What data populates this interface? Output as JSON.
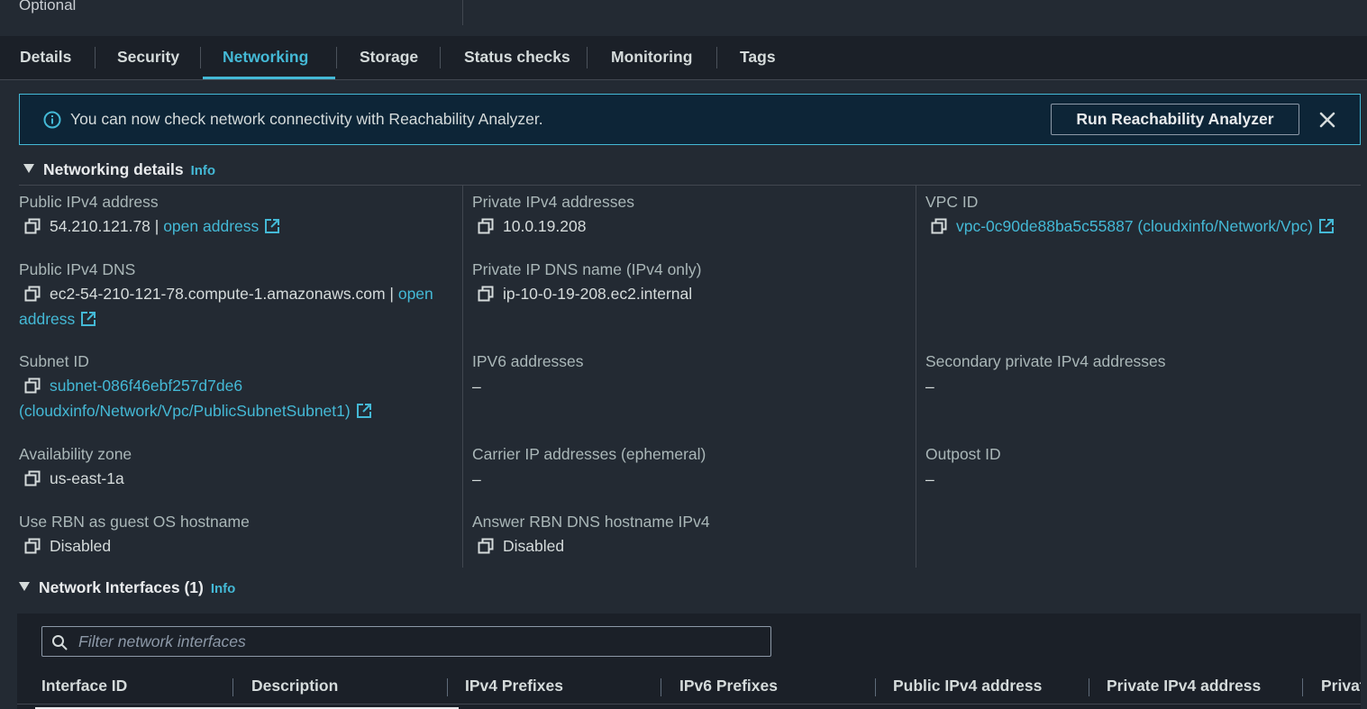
{
  "top": {
    "optional_label": "Optional"
  },
  "tabs": [
    {
      "label": "Details"
    },
    {
      "label": "Security"
    },
    {
      "label": "Networking"
    },
    {
      "label": "Storage"
    },
    {
      "label": "Status checks"
    },
    {
      "label": "Monitoring"
    },
    {
      "label": "Tags"
    }
  ],
  "active_tab": "Networking",
  "alert": {
    "message": "You can now check network connectivity with Reachability Analyzer.",
    "button_label": "Run Reachability Analyzer"
  },
  "networking_details": {
    "title": "Networking details",
    "info": "Info",
    "public_ipv4": {
      "label": "Public IPv4 address",
      "value": "54.210.121.78",
      "sep": " | ",
      "link": "open address"
    },
    "private_ipv4": {
      "label": "Private IPv4 addresses",
      "value": "10.0.19.208"
    },
    "vpc_id": {
      "label": "VPC ID",
      "link": "vpc-0c90de88ba5c55887 (cloudxinfo/Network/Vpc)"
    },
    "public_dns": {
      "label": "Public IPv4 DNS",
      "value": "ec2-54-210-121-78.compute-1.amazonaws.com",
      "sep": " | ",
      "link_1": "open",
      "link_2": "address"
    },
    "private_dns": {
      "label": "Private IP DNS name (IPv4 only)",
      "value": "ip-10-0-19-208.ec2.internal"
    },
    "subnet_id": {
      "label": "Subnet ID",
      "link_1": "subnet-086f46ebf257d7de6",
      "link_2": "(cloudxinfo/Network/Vpc/PublicSubnetSubnet1)"
    },
    "ipv6": {
      "label": "IPV6 addresses",
      "value": "–"
    },
    "secondary_private": {
      "label": "Secondary private IPv4 addresses",
      "value": "–"
    },
    "az": {
      "label": "Availability zone",
      "value": "us-east-1a"
    },
    "carrier_ip": {
      "label": "Carrier IP addresses (ephemeral)",
      "value": "–"
    },
    "outpost": {
      "label": "Outpost ID",
      "value": "–"
    },
    "rbn_hostname": {
      "label": "Use RBN as guest OS hostname",
      "value": "Disabled"
    },
    "answer_rbn": {
      "label": "Answer RBN DNS hostname IPv4",
      "value": "Disabled"
    }
  },
  "network_interfaces": {
    "title": "Network Interfaces (1)",
    "info": "Info",
    "filter_placeholder": "Filter network interfaces",
    "columns": [
      "Interface ID",
      "Description",
      "IPv4 Prefixes",
      "IPv6 Prefixes",
      "Public IPv4 address",
      "Private IPv4 address",
      "Privat"
    ]
  },
  "colors": {
    "accent": "#44b9d6",
    "background": "#232a33",
    "panel": "#1b2028"
  }
}
